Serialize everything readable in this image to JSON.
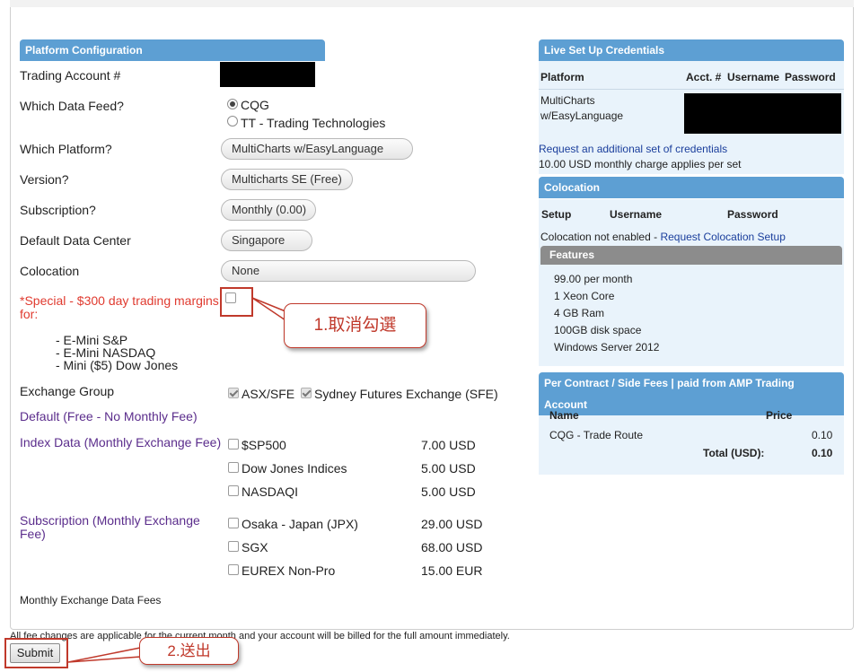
{
  "platform_config": {
    "header": "Platform Configuration",
    "trading_account_label": "Trading Account #",
    "data_feed_label": "Which Data Feed?",
    "data_feed_options": [
      "CQG",
      "TT - Trading Technologies"
    ],
    "platform_label": "Which Platform?",
    "platform_value": "MultiCharts w/EasyLanguage",
    "version_label": "Version?",
    "version_value": "Multicharts SE (Free)",
    "subscription_label": "Subscription?",
    "subscription_value": "Monthly (0.00)",
    "data_center_label": "Default Data Center",
    "data_center_value": "Singapore",
    "colocation_label": "Colocation",
    "colocation_value": "None",
    "special_label": "*Special - $300 day trading margins for:",
    "special_items": [
      "- E-Mini S&P",
      "- E-Mini NASDAQ",
      "- Mini ($5) Dow Jones"
    ],
    "exchange_group_label": "Exchange Group",
    "exchange_group_items": [
      "ASX/SFE",
      "Sydney Futures Exchange (SFE)"
    ],
    "default_label": "Default (Free - No Monthly Fee)",
    "index_data_label": "Index Data (Monthly Exchange Fee)",
    "index_data_items": [
      {
        "name": "$SP500",
        "price": "7.00 USD"
      },
      {
        "name": "Dow Jones Indices",
        "price": "5.00 USD"
      },
      {
        "name": "NASDAQI",
        "price": "5.00 USD"
      }
    ],
    "subscription_fee_label": "Subscription (Monthly Exchange Fee)",
    "subscription_fee_items": [
      {
        "name": "Osaka - Japan (JPX)",
        "price": "29.00 USD"
      },
      {
        "name": "SGX",
        "price": "68.00 USD"
      },
      {
        "name": "EUREX Non-Pro",
        "price": "15.00 EUR"
      }
    ],
    "monthly_fees_link": "Monthly Exchange Data Fees"
  },
  "credentials": {
    "header": "Live Set Up Credentials",
    "col_platform": "Platform",
    "col_acct": "Acct. #",
    "col_username": "Username",
    "col_password": "Password",
    "row_platform_line1": "MultiCharts",
    "row_platform_line2": "w/EasyLanguage",
    "request_link": "Request an additional set of credentials",
    "charge_note": "10.00 USD monthly charge applies per set"
  },
  "colocation": {
    "header": "Colocation",
    "col_setup": "Setup",
    "col_username": "Username",
    "col_password": "Password",
    "status": "Colocation not enabled - ",
    "request_link": "Request Colocation Setup",
    "features_header": "Features",
    "features": [
      "99.00 per month",
      "1 Xeon Core",
      "4 GB Ram",
      "100GB disk space",
      "Windows Server 2012"
    ]
  },
  "fees": {
    "header": "Per Contract / Side Fees | paid from AMP Trading Account",
    "col_name": "Name",
    "col_price": "Price",
    "row_name": "CQG - Trade Route",
    "row_price": "0.10",
    "total_label": "Total (USD):",
    "total_value": "0.10"
  },
  "footer": {
    "note": "All fee changes are applicable for the current month and your account will be billed for the full amount immediately.",
    "submit_label": "Submit"
  },
  "annotations": {
    "callout1": "1.取消勾選",
    "callout2": "2.送出"
  },
  "colors": {
    "section_header": "#5d9fd3",
    "accent_red": "#c0392b",
    "purple_text": "#5b2d8c"
  }
}
